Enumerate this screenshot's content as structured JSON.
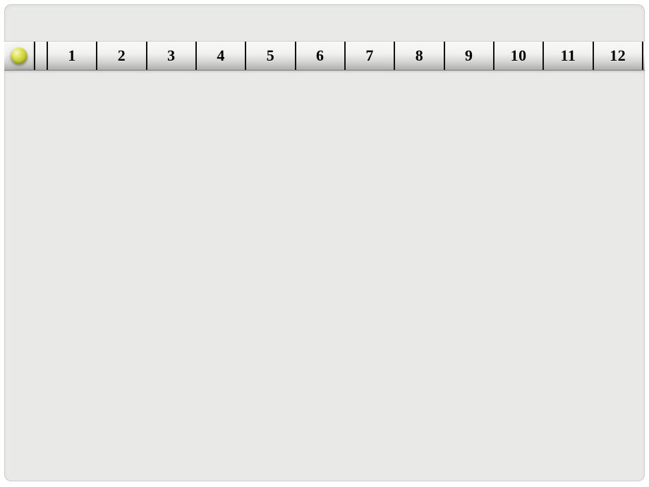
{
  "ruler": {
    "segments": [
      {
        "label": "1"
      },
      {
        "label": "2"
      },
      {
        "label": "3"
      },
      {
        "label": "4"
      },
      {
        "label": "5"
      },
      {
        "label": "6"
      },
      {
        "label": "7"
      },
      {
        "label": "8"
      },
      {
        "label": "9"
      },
      {
        "label": "10"
      },
      {
        "label": "11"
      },
      {
        "label": "12"
      }
    ],
    "dot_color": "#cdd33f"
  }
}
